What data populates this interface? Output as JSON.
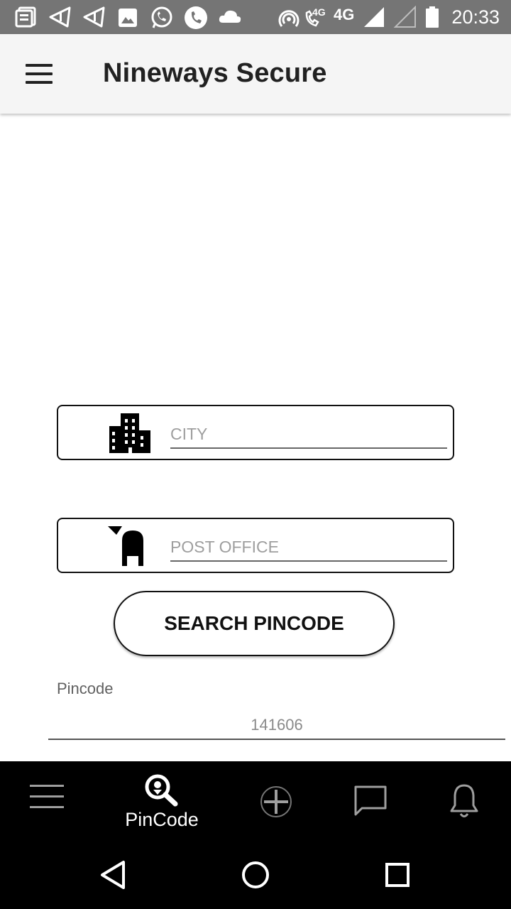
{
  "status_bar": {
    "time": "20:33",
    "network_small": "4G",
    "network_large": "4G",
    "icons": [
      "notes-icon",
      "navigation-icon",
      "navigation-icon",
      "image-icon",
      "whatsapp-icon",
      "phone-icon",
      "cloud-icon",
      "hotspot-icon",
      "volte-call-icon",
      "signal-icon",
      "signal-empty-icon",
      "battery-icon"
    ]
  },
  "app_bar": {
    "title": "Nineways Secure",
    "menu_icon": "hamburger-icon"
  },
  "form": {
    "city": {
      "placeholder": "CITY",
      "value": "",
      "icon": "city-buildings-icon"
    },
    "post_office": {
      "placeholder": "POST OFFICE",
      "value": "",
      "icon": "mailbox-icon"
    },
    "search_button": "SEARCH PINCODE",
    "pincode_label": "Pincode",
    "pincode_value": "141606"
  },
  "bottom_nav": {
    "items": [
      {
        "label": "",
        "icon": "menu-lines-icon"
      },
      {
        "label": "PinCode",
        "icon": "search-location-icon",
        "active": true
      },
      {
        "label": "",
        "icon": "add-circle-icon"
      },
      {
        "label": "",
        "icon": "chat-bubble-icon"
      },
      {
        "label": "",
        "icon": "bell-icon"
      }
    ]
  },
  "system_nav": {
    "icons": [
      "back-triangle-icon",
      "home-circle-icon",
      "recents-square-icon"
    ]
  },
  "colors": {
    "status_bar": "#757575",
    "app_bar": "#f5f5f5",
    "nav_bg": "#000000",
    "accent": "#111111"
  }
}
